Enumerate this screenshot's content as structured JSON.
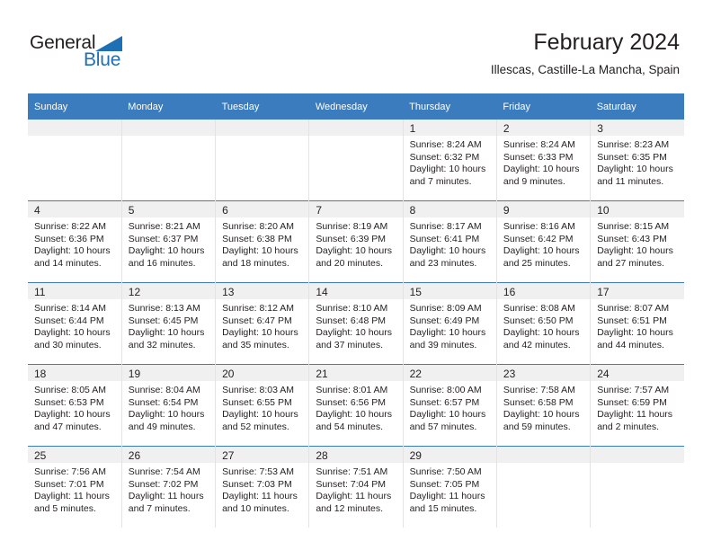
{
  "brand": {
    "name_part1": "General",
    "name_part2": "Blue",
    "accent_color": "#1f6fb5"
  },
  "header": {
    "title": "February 2024",
    "subtitle": "Illescas, Castille-La Mancha, Spain"
  },
  "calendar": {
    "header_bg": "#3a7cbe",
    "daynum_bg": "#f0f0f0",
    "weekday_headers": [
      "Sunday",
      "Monday",
      "Tuesday",
      "Wednesday",
      "Thursday",
      "Friday",
      "Saturday"
    ],
    "weeks": [
      [
        {
          "day": "",
          "sunrise": "",
          "sunset": "",
          "daylight1": "",
          "daylight2": ""
        },
        {
          "day": "",
          "sunrise": "",
          "sunset": "",
          "daylight1": "",
          "daylight2": ""
        },
        {
          "day": "",
          "sunrise": "",
          "sunset": "",
          "daylight1": "",
          "daylight2": ""
        },
        {
          "day": "",
          "sunrise": "",
          "sunset": "",
          "daylight1": "",
          "daylight2": ""
        },
        {
          "day": "1",
          "sunrise": "Sunrise: 8:24 AM",
          "sunset": "Sunset: 6:32 PM",
          "daylight1": "Daylight: 10 hours",
          "daylight2": "and 7 minutes."
        },
        {
          "day": "2",
          "sunrise": "Sunrise: 8:24 AM",
          "sunset": "Sunset: 6:33 PM",
          "daylight1": "Daylight: 10 hours",
          "daylight2": "and 9 minutes."
        },
        {
          "day": "3",
          "sunrise": "Sunrise: 8:23 AM",
          "sunset": "Sunset: 6:35 PM",
          "daylight1": "Daylight: 10 hours",
          "daylight2": "and 11 minutes."
        }
      ],
      [
        {
          "day": "4",
          "sunrise": "Sunrise: 8:22 AM",
          "sunset": "Sunset: 6:36 PM",
          "daylight1": "Daylight: 10 hours",
          "daylight2": "and 14 minutes."
        },
        {
          "day": "5",
          "sunrise": "Sunrise: 8:21 AM",
          "sunset": "Sunset: 6:37 PM",
          "daylight1": "Daylight: 10 hours",
          "daylight2": "and 16 minutes."
        },
        {
          "day": "6",
          "sunrise": "Sunrise: 8:20 AM",
          "sunset": "Sunset: 6:38 PM",
          "daylight1": "Daylight: 10 hours",
          "daylight2": "and 18 minutes."
        },
        {
          "day": "7",
          "sunrise": "Sunrise: 8:19 AM",
          "sunset": "Sunset: 6:39 PM",
          "daylight1": "Daylight: 10 hours",
          "daylight2": "and 20 minutes."
        },
        {
          "day": "8",
          "sunrise": "Sunrise: 8:17 AM",
          "sunset": "Sunset: 6:41 PM",
          "daylight1": "Daylight: 10 hours",
          "daylight2": "and 23 minutes."
        },
        {
          "day": "9",
          "sunrise": "Sunrise: 8:16 AM",
          "sunset": "Sunset: 6:42 PM",
          "daylight1": "Daylight: 10 hours",
          "daylight2": "and 25 minutes."
        },
        {
          "day": "10",
          "sunrise": "Sunrise: 8:15 AM",
          "sunset": "Sunset: 6:43 PM",
          "daylight1": "Daylight: 10 hours",
          "daylight2": "and 27 minutes."
        }
      ],
      [
        {
          "day": "11",
          "sunrise": "Sunrise: 8:14 AM",
          "sunset": "Sunset: 6:44 PM",
          "daylight1": "Daylight: 10 hours",
          "daylight2": "and 30 minutes."
        },
        {
          "day": "12",
          "sunrise": "Sunrise: 8:13 AM",
          "sunset": "Sunset: 6:45 PM",
          "daylight1": "Daylight: 10 hours",
          "daylight2": "and 32 minutes."
        },
        {
          "day": "13",
          "sunrise": "Sunrise: 8:12 AM",
          "sunset": "Sunset: 6:47 PM",
          "daylight1": "Daylight: 10 hours",
          "daylight2": "and 35 minutes."
        },
        {
          "day": "14",
          "sunrise": "Sunrise: 8:10 AM",
          "sunset": "Sunset: 6:48 PM",
          "daylight1": "Daylight: 10 hours",
          "daylight2": "and 37 minutes."
        },
        {
          "day": "15",
          "sunrise": "Sunrise: 8:09 AM",
          "sunset": "Sunset: 6:49 PM",
          "daylight1": "Daylight: 10 hours",
          "daylight2": "and 39 minutes."
        },
        {
          "day": "16",
          "sunrise": "Sunrise: 8:08 AM",
          "sunset": "Sunset: 6:50 PM",
          "daylight1": "Daylight: 10 hours",
          "daylight2": "and 42 minutes."
        },
        {
          "day": "17",
          "sunrise": "Sunrise: 8:07 AM",
          "sunset": "Sunset: 6:51 PM",
          "daylight1": "Daylight: 10 hours",
          "daylight2": "and 44 minutes."
        }
      ],
      [
        {
          "day": "18",
          "sunrise": "Sunrise: 8:05 AM",
          "sunset": "Sunset: 6:53 PM",
          "daylight1": "Daylight: 10 hours",
          "daylight2": "and 47 minutes."
        },
        {
          "day": "19",
          "sunrise": "Sunrise: 8:04 AM",
          "sunset": "Sunset: 6:54 PM",
          "daylight1": "Daylight: 10 hours",
          "daylight2": "and 49 minutes."
        },
        {
          "day": "20",
          "sunrise": "Sunrise: 8:03 AM",
          "sunset": "Sunset: 6:55 PM",
          "daylight1": "Daylight: 10 hours",
          "daylight2": "and 52 minutes."
        },
        {
          "day": "21",
          "sunrise": "Sunrise: 8:01 AM",
          "sunset": "Sunset: 6:56 PM",
          "daylight1": "Daylight: 10 hours",
          "daylight2": "and 54 minutes."
        },
        {
          "day": "22",
          "sunrise": "Sunrise: 8:00 AM",
          "sunset": "Sunset: 6:57 PM",
          "daylight1": "Daylight: 10 hours",
          "daylight2": "and 57 minutes."
        },
        {
          "day": "23",
          "sunrise": "Sunrise: 7:58 AM",
          "sunset": "Sunset: 6:58 PM",
          "daylight1": "Daylight: 10 hours",
          "daylight2": "and 59 minutes."
        },
        {
          "day": "24",
          "sunrise": "Sunrise: 7:57 AM",
          "sunset": "Sunset: 6:59 PM",
          "daylight1": "Daylight: 11 hours",
          "daylight2": "and 2 minutes."
        }
      ],
      [
        {
          "day": "25",
          "sunrise": "Sunrise: 7:56 AM",
          "sunset": "Sunset: 7:01 PM",
          "daylight1": "Daylight: 11 hours",
          "daylight2": "and 5 minutes."
        },
        {
          "day": "26",
          "sunrise": "Sunrise: 7:54 AM",
          "sunset": "Sunset: 7:02 PM",
          "daylight1": "Daylight: 11 hours",
          "daylight2": "and 7 minutes."
        },
        {
          "day": "27",
          "sunrise": "Sunrise: 7:53 AM",
          "sunset": "Sunset: 7:03 PM",
          "daylight1": "Daylight: 11 hours",
          "daylight2": "and 10 minutes."
        },
        {
          "day": "28",
          "sunrise": "Sunrise: 7:51 AM",
          "sunset": "Sunset: 7:04 PM",
          "daylight1": "Daylight: 11 hours",
          "daylight2": "and 12 minutes."
        },
        {
          "day": "29",
          "sunrise": "Sunrise: 7:50 AM",
          "sunset": "Sunset: 7:05 PM",
          "daylight1": "Daylight: 11 hours",
          "daylight2": "and 15 minutes."
        },
        {
          "day": "",
          "sunrise": "",
          "sunset": "",
          "daylight1": "",
          "daylight2": ""
        },
        {
          "day": "",
          "sunrise": "",
          "sunset": "",
          "daylight1": "",
          "daylight2": ""
        }
      ]
    ]
  }
}
